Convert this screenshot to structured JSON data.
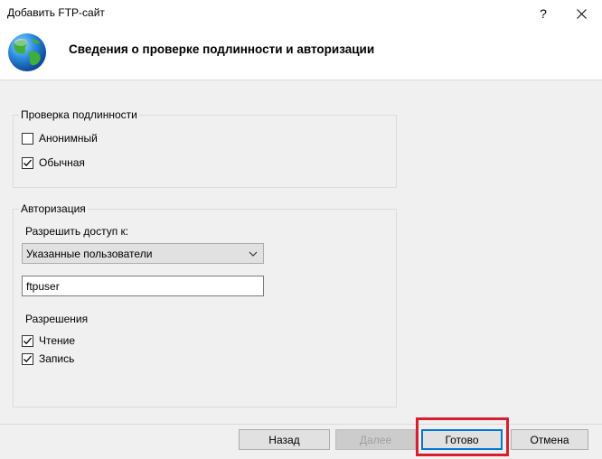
{
  "window": {
    "title": "Добавить FTP-сайт",
    "help_label": "?"
  },
  "header": {
    "heading": "Сведения о проверке подлинности и авторизации",
    "icon": "globe-icon"
  },
  "authentication": {
    "title": "Проверка подлинности",
    "anonymous": {
      "label": "Анонимный",
      "checked": false
    },
    "basic": {
      "label": "Обычная",
      "checked": true
    }
  },
  "authorization": {
    "title": "Авторизация",
    "allow_access_label": "Разрешить доступ к:",
    "allow_access_value": "Указанные пользователи",
    "users_value": "ftpuser",
    "permissions_title": "Разрешения",
    "read": {
      "label": "Чтение",
      "checked": true
    },
    "write": {
      "label": "Запись",
      "checked": true
    }
  },
  "footer": {
    "back_label": "Назад",
    "next_label": "Далее",
    "finish_label": "Готово",
    "cancel_label": "Отмена"
  },
  "colors": {
    "highlight": "#d6202e",
    "primary_border": "#0078d7",
    "panel_bg": "#f0f0f0"
  }
}
